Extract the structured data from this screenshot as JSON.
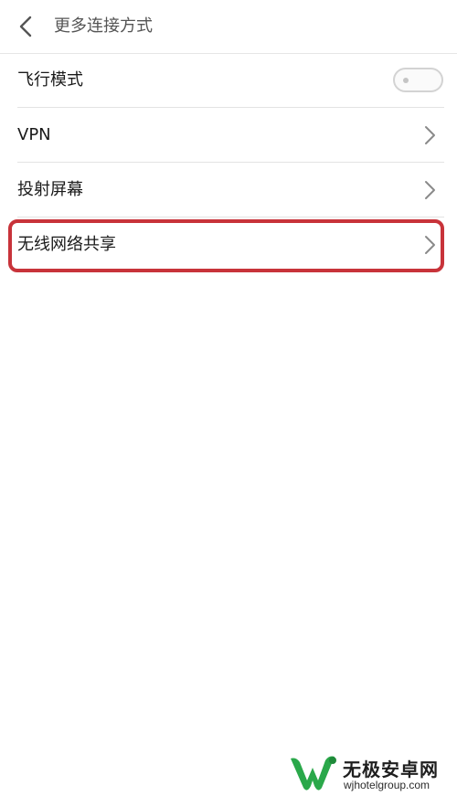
{
  "header": {
    "title": "更多连接方式",
    "back_icon": "chevron-left-icon"
  },
  "list": {
    "items": [
      {
        "label": "飞行模式",
        "control": "toggle",
        "toggle_on": false
      },
      {
        "label": "VPN",
        "control": "chevron"
      },
      {
        "label": "投射屏幕",
        "control": "chevron"
      },
      {
        "label": "无线网络共享",
        "control": "chevron",
        "highlighted": true
      }
    ]
  },
  "annotation": {
    "highlight_color": "#c8333a"
  },
  "watermark": {
    "brand": "无极安卓网",
    "url": "wjhotelgroup.com",
    "logo_color": "#2aa84a"
  }
}
